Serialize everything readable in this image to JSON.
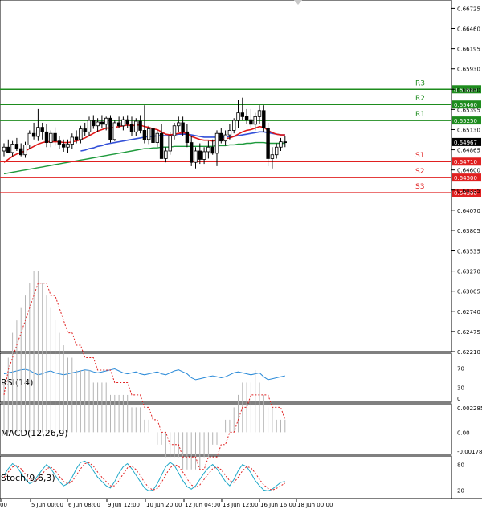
{
  "chart_data": {
    "type": "candlestick",
    "main": {
      "y_range": [
        0.6221,
        0.66835
      ],
      "y_ticks": [
        "0.66725",
        "0.66460",
        "0.66195",
        "0.65930",
        "0.65660",
        "0.65395",
        "0.65130",
        "0.64865",
        "0.64600",
        "0.64335",
        "0.64070",
        "0.63805",
        "0.63535",
        "0.63270",
        "0.63005",
        "0.62740",
        "0.62475",
        "0.62210"
      ],
      "x_labels": [
        "00",
        "5 Jun 00:00",
        "6 Jun 08:00",
        "9 Jun 12:00",
        "10 Jun 20:00",
        "12 Jun 04:00",
        "13 Jun 12:00",
        "16 Jun 16:00",
        "18 Jun 00:00"
      ],
      "candles": [
        [
          0.6485,
          0.6495,
          0.6478,
          0.649
        ],
        [
          0.649,
          0.65,
          0.6482,
          0.6483
        ],
        [
          0.6483,
          0.6498,
          0.6478,
          0.6494
        ],
        [
          0.6494,
          0.6502,
          0.6485,
          0.6488
        ],
        [
          0.6488,
          0.6495,
          0.6478,
          0.648
        ],
        [
          0.648,
          0.6497,
          0.6476,
          0.6493
        ],
        [
          0.6493,
          0.6512,
          0.6488,
          0.6508
        ],
        [
          0.6508,
          0.6522,
          0.65,
          0.6504
        ],
        [
          0.6504,
          0.654,
          0.6498,
          0.6516
        ],
        [
          0.6516,
          0.6522,
          0.65,
          0.651
        ],
        [
          0.651,
          0.652,
          0.649,
          0.6496
        ],
        [
          0.6496,
          0.6512,
          0.649,
          0.6508
        ],
        [
          0.6508,
          0.6516,
          0.6492,
          0.6498
        ],
        [
          0.6498,
          0.6505,
          0.6488,
          0.6494
        ],
        [
          0.6494,
          0.65,
          0.6484,
          0.649
        ],
        [
          0.649,
          0.65,
          0.6482,
          0.6494
        ],
        [
          0.6494,
          0.6508,
          0.6488,
          0.6503
        ],
        [
          0.6503,
          0.6512,
          0.6495,
          0.65
        ],
        [
          0.65,
          0.6518,
          0.6495,
          0.6514
        ],
        [
          0.6514,
          0.6522,
          0.6505,
          0.651
        ],
        [
          0.651,
          0.653,
          0.6505,
          0.6525
        ],
        [
          0.6525,
          0.6532,
          0.6514,
          0.6518
        ],
        [
          0.6518,
          0.6528,
          0.651,
          0.6523
        ],
        [
          0.6523,
          0.6532,
          0.6515,
          0.652
        ],
        [
          0.652,
          0.653,
          0.6512,
          0.6528
        ],
        [
          0.6528,
          0.6532,
          0.6496,
          0.65
        ],
        [
          0.65,
          0.6525,
          0.6498,
          0.6522
        ],
        [
          0.6522,
          0.653,
          0.6515,
          0.6518
        ],
        [
          0.6518,
          0.653,
          0.6512,
          0.6526
        ],
        [
          0.6526,
          0.6532,
          0.6515,
          0.652
        ],
        [
          0.652,
          0.653,
          0.6505,
          0.651
        ],
        [
          0.651,
          0.6528,
          0.6505,
          0.6524
        ],
        [
          0.6524,
          0.6532,
          0.6508,
          0.6512
        ],
        [
          0.6512,
          0.6545,
          0.6495,
          0.65
        ],
        [
          0.65,
          0.6518,
          0.6494,
          0.6514
        ],
        [
          0.6514,
          0.652,
          0.6492,
          0.6496
        ],
        [
          0.6496,
          0.6512,
          0.649,
          0.6508
        ],
        [
          0.6508,
          0.652,
          0.6488,
          0.6475
        ],
        [
          0.6475,
          0.649,
          0.647,
          0.6485
        ],
        [
          0.6485,
          0.651,
          0.648,
          0.6505
        ],
        [
          0.6505,
          0.6522,
          0.65,
          0.6518
        ],
        [
          0.6518,
          0.653,
          0.651,
          0.6522
        ],
        [
          0.6522,
          0.653,
          0.6505,
          0.651
        ],
        [
          0.651,
          0.652,
          0.649,
          0.6496
        ],
        [
          0.6496,
          0.6505,
          0.6465,
          0.647
        ],
        [
          0.647,
          0.649,
          0.6462,
          0.6485
        ],
        [
          0.6485,
          0.6495,
          0.6468,
          0.6474
        ],
        [
          0.6474,
          0.649,
          0.6468,
          0.6484
        ],
        [
          0.6484,
          0.6498,
          0.6475,
          0.649
        ],
        [
          0.649,
          0.65,
          0.648,
          0.6482
        ],
        [
          0.6482,
          0.6512,
          0.6465,
          0.6508
        ],
        [
          0.6508,
          0.6515,
          0.6495,
          0.6498
        ],
        [
          0.6498,
          0.6512,
          0.6492,
          0.6506
        ],
        [
          0.6506,
          0.652,
          0.65,
          0.6512
        ],
        [
          0.6512,
          0.6528,
          0.6508,
          0.6525
        ],
        [
          0.6525,
          0.6552,
          0.6515,
          0.6535
        ],
        [
          0.6535,
          0.6555,
          0.6525,
          0.653
        ],
        [
          0.653,
          0.654,
          0.652,
          0.6526
        ],
        [
          0.6526,
          0.654,
          0.6515,
          0.652
        ],
        [
          0.652,
          0.6535,
          0.6512,
          0.653
        ],
        [
          0.653,
          0.6545,
          0.652,
          0.6538
        ],
        [
          0.6538,
          0.6545,
          0.651,
          0.6515
        ],
        [
          0.6515,
          0.6522,
          0.6465,
          0.6475
        ],
        [
          0.6475,
          0.649,
          0.6462,
          0.648
        ],
        [
          0.648,
          0.6495,
          0.6475,
          0.649
        ],
        [
          0.649,
          0.6502,
          0.6485,
          0.6497
        ],
        [
          0.6497,
          0.6505,
          0.649,
          0.6496
        ]
      ],
      "ma_red": [
        0.647,
        0.6474,
        0.6478,
        0.6481,
        0.6483,
        0.6485,
        0.6488,
        0.6491,
        0.6494,
        0.6496,
        0.6497,
        0.6497,
        0.6497,
        0.6497,
        0.6496,
        0.6496,
        0.6497,
        0.6498,
        0.65,
        0.6502,
        0.6505,
        0.6508,
        0.6511,
        0.6513,
        0.6515,
        0.6515,
        0.6516,
        0.6517,
        0.6518,
        0.6519,
        0.6518,
        0.6519,
        0.6519,
        0.6517,
        0.6516,
        0.6514,
        0.6513,
        0.651,
        0.6507,
        0.6506,
        0.6507,
        0.6508,
        0.6509,
        0.6508,
        0.6504,
        0.6502,
        0.65,
        0.6499,
        0.6499,
        0.6498,
        0.6499,
        0.65,
        0.6501,
        0.6502,
        0.6504,
        0.6507,
        0.651,
        0.6512,
        0.6513,
        0.6515,
        0.6517,
        0.6516,
        0.6512,
        0.6509,
        0.6507,
        0.6506,
        0.6506
      ],
      "ma_blue": [
        null,
        null,
        null,
        null,
        null,
        null,
        null,
        null,
        null,
        null,
        null,
        null,
        null,
        null,
        null,
        null,
        null,
        null,
        0.6485,
        0.6486,
        0.6488,
        0.6489,
        0.6491,
        0.6492,
        0.6494,
        0.6495,
        0.6496,
        0.6497,
        0.6498,
        0.6499,
        0.65,
        0.6501,
        0.6502,
        0.6503,
        0.6504,
        0.6504,
        0.6505,
        0.6505,
        0.6505,
        0.6505,
        0.6506,
        0.6507,
        0.6507,
        0.6507,
        0.6506,
        0.6505,
        0.6504,
        0.6503,
        0.6503,
        0.6503,
        0.6503,
        0.6503,
        0.6503,
        0.6504,
        0.6504,
        0.6505,
        0.6506,
        0.6507,
        0.6508,
        0.6509,
        0.651,
        0.651,
        0.6509,
        0.6508,
        0.6507,
        0.6506,
        0.6506
      ],
      "ma_green": [
        0.6455,
        0.6456,
        0.6457,
        0.6458,
        0.6459,
        0.646,
        0.6461,
        0.6462,
        0.6463,
        0.6464,
        0.6465,
        0.6466,
        0.6467,
        0.6468,
        0.6469,
        0.647,
        0.6471,
        0.6472,
        0.6473,
        0.6474,
        0.6475,
        0.6476,
        0.6477,
        0.6478,
        0.6479,
        0.648,
        0.6481,
        0.6482,
        0.6483,
        0.6484,
        0.6485,
        0.6486,
        0.6487,
        0.6488,
        0.6488,
        0.6489,
        0.6489,
        0.649,
        0.649,
        0.649,
        0.6491,
        0.6491,
        0.6491,
        0.6491,
        0.6491,
        0.6491,
        0.6491,
        0.6491,
        0.6491,
        0.6491,
        0.6492,
        0.6492,
        0.6492,
        0.6493,
        0.6493,
        0.6494,
        0.6494,
        0.6495,
        0.6495,
        0.6496,
        0.6496,
        0.6496,
        0.6495,
        0.6495,
        0.6495,
        0.6495,
        0.6495
      ],
      "levels": [
        {
          "name": "R3",
          "value": 0.6566,
          "label": "0.65660",
          "color": "#1e8c1e"
        },
        {
          "name": "R2",
          "value": 0.6546,
          "label": "0.65460",
          "color": "#1e8c1e"
        },
        {
          "name": "R1",
          "value": 0.6525,
          "label": "0.65250",
          "color": "#1e8c1e"
        },
        {
          "name": "S1",
          "value": 0.6471,
          "label": "0.64710",
          "color": "#e02020"
        },
        {
          "name": "S2",
          "value": 0.645,
          "label": "0.64500",
          "color": "#e02020"
        },
        {
          "name": "S3",
          "value": 0.643,
          "label": "0.64300",
          "color": "#e02020"
        }
      ],
      "current_price": {
        "value": 0.64967,
        "label": "0.64967"
      }
    },
    "rsi": {
      "label": "RSI(14)",
      "y_range": [
        0,
        100
      ],
      "ticks": [
        "70",
        "30",
        "0"
      ],
      "values": [
        58,
        60,
        62,
        64,
        66,
        67,
        65,
        60,
        56,
        58,
        62,
        64,
        60,
        58,
        56,
        58,
        60,
        62,
        64,
        66,
        65,
        62,
        60,
        62,
        64,
        66,
        68,
        64,
        60,
        58,
        60,
        62,
        58,
        56,
        58,
        60,
        62,
        58,
        56,
        60,
        64,
        66,
        62,
        58,
        50,
        46,
        48,
        50,
        52,
        54,
        52,
        50,
        52,
        56,
        60,
        62,
        60,
        58,
        56,
        58,
        60,
        52,
        46,
        48,
        50,
        52,
        54
      ]
    },
    "macd": {
      "label": "MACD(12,26,9)",
      "y_range": [
        -0.01786,
        0.02285
      ],
      "ticks": [
        "0.002285",
        "0.00",
        "-0.001786"
      ],
      "histogram": [
        0.0004,
        0.0006,
        0.0008,
        0.0009,
        0.001,
        0.0011,
        0.0012,
        0.0013,
        0.0013,
        0.0012,
        0.0011,
        0.001,
        0.0009,
        0.0008,
        0.0007,
        0.0006,
        0.0006,
        0.0005,
        0.0005,
        0.0005,
        0.0005,
        0.0004,
        0.0004,
        0.0004,
        0.0004,
        0.0003,
        0.0003,
        0.0003,
        0.0003,
        0.0003,
        0.0002,
        0.0002,
        0.0002,
        0.0001,
        0.0001,
        0.0,
        -0.0001,
        -0.0001,
        -0.0002,
        -0.0002,
        -0.0002,
        -0.0002,
        -0.0003,
        -0.0003,
        -0.0003,
        -0.0003,
        -0.0003,
        -0.0002,
        -0.0002,
        -0.0001,
        -0.0001,
        0.0,
        0.0001,
        0.0001,
        0.0002,
        0.0003,
        0.0004,
        0.0004,
        0.0004,
        0.0005,
        0.0004,
        0.0003,
        0.0002,
        0.0002,
        0.0001,
        0.0001,
        0.0001
      ],
      "signal": [
        0.0003,
        0.0005,
        0.0006,
        0.0007,
        0.0008,
        0.0009,
        0.001,
        0.0011,
        0.0012,
        0.0012,
        0.0012,
        0.0011,
        0.0011,
        0.001,
        0.0009,
        0.0008,
        0.0008,
        0.0007,
        0.0007,
        0.0006,
        0.0006,
        0.0006,
        0.0005,
        0.0005,
        0.0005,
        0.0005,
        0.0004,
        0.0004,
        0.0004,
        0.0004,
        0.0003,
        0.0003,
        0.0003,
        0.0002,
        0.0002,
        0.0001,
        0.0001,
        0.0,
        0.0,
        -0.0001,
        -0.0001,
        -0.0001,
        -0.0002,
        -0.0002,
        -0.0002,
        -0.0002,
        -0.0003,
        -0.0003,
        -0.0002,
        -0.0002,
        -0.0002,
        -0.0001,
        -0.0001,
        0.0,
        0.0,
        0.0001,
        0.0002,
        0.0002,
        0.0003,
        0.0003,
        0.0003,
        0.0003,
        0.0003,
        0.0002,
        0.0002,
        0.0002,
        0.0001
      ]
    },
    "stoch": {
      "label": "Stoch(9,6,3)",
      "y_range": [
        0,
        100
      ],
      "ticks": [
        "80",
        "20"
      ],
      "main": [
        55,
        70,
        82,
        75,
        60,
        45,
        35,
        40,
        55,
        68,
        80,
        70,
        55,
        40,
        30,
        35,
        50,
        70,
        85,
        88,
        80,
        65,
        50,
        40,
        30,
        25,
        40,
        60,
        75,
        82,
        70,
        55,
        40,
        25,
        18,
        20,
        35,
        55,
        75,
        85,
        78,
        60,
        42,
        28,
        22,
        30,
        45,
        60,
        72,
        80,
        70,
        55,
        40,
        30,
        45,
        65,
        80,
        75,
        60,
        42,
        30,
        20,
        18,
        22,
        30,
        38,
        40
      ],
      "signal": [
        50,
        62,
        74,
        78,
        70,
        58,
        46,
        40,
        46,
        58,
        70,
        74,
        66,
        52,
        40,
        34,
        40,
        55,
        70,
        82,
        84,
        76,
        62,
        50,
        40,
        30,
        30,
        42,
        58,
        72,
        76,
        68,
        54,
        38,
        26,
        20,
        24,
        38,
        56,
        72,
        80,
        76,
        62,
        46,
        32,
        26,
        32,
        45,
        58,
        70,
        74,
        68,
        54,
        42,
        38,
        50,
        65,
        75,
        72,
        60,
        45,
        32,
        24,
        20,
        24,
        30,
        36
      ]
    }
  }
}
